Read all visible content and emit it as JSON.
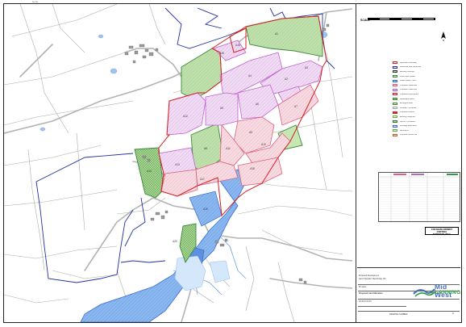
{
  "drawing": {
    "top_note": "Plan Ref:",
    "scale_label": "SCALE",
    "north_symbol": "N",
    "development_note": "FOR DEVELOPMENT\nCONTROL\nPURPOSES ONLY",
    "title_block": {
      "project": "Proposed Development",
      "subtitle": "Land Opposite: Sketchmap 123",
      "name_label": "M Loane",
      "drawing_title": "Proposed Land Allocation",
      "drawing_number": "20-20-P-01-03",
      "footer": "DRAWING NUMBER",
      "sheet": "A"
    },
    "logo": {
      "line1": "Mid West",
      "line2": "PLANNING"
    }
  },
  "map": {
    "parcels": [
      {
        "id": "A1",
        "label": "A1"
      },
      {
        "id": "A2",
        "label": "A2"
      },
      {
        "id": "A3",
        "label": "A3"
      },
      {
        "id": "A4",
        "label": "A4"
      },
      {
        "id": "A5",
        "label": "A5"
      },
      {
        "id": "A6",
        "label": "A6"
      },
      {
        "id": "A7",
        "label": "A7"
      },
      {
        "id": "A8",
        "label": "A8"
      },
      {
        "id": "A9",
        "label": "A9"
      },
      {
        "id": "A10",
        "label": "A10"
      },
      {
        "id": "A11",
        "label": "A11"
      },
      {
        "id": "A12",
        "label": "A12"
      },
      {
        "id": "A13",
        "label": "A13"
      },
      {
        "id": "A14",
        "label": "A14"
      },
      {
        "id": "A15",
        "label": "A15"
      },
      {
        "id": "A16",
        "label": "A16"
      },
      {
        "id": "A17",
        "label": "A17"
      },
      {
        "id": "A18",
        "label": "A18"
      },
      {
        "id": "A19",
        "label": "A19"
      },
      {
        "id": "A20",
        "label": "A20"
      }
    ]
  },
  "legend": {
    "items": [
      {
        "label": "Application boundary",
        "stroke": "#d62020",
        "fill": "none"
      },
      {
        "label": "Additional land ownership",
        "stroke": "#2030a0",
        "fill": "none"
      },
      {
        "label": "Existing buildings",
        "stroke": "#333333",
        "fill": "#cccccc"
      },
      {
        "label": "Public open space",
        "stroke": "#3a8a3a",
        "fill": "#c8e6b4"
      },
      {
        "label": "Water bodies / flood",
        "stroke": "#3a6ad4",
        "fill": "#9ec4ef"
      },
      {
        "label": "Proposed residential",
        "stroke": "#d85a8a",
        "fill": "#f3c6d6"
      },
      {
        "label": "Proposed mixed use",
        "stroke": "#b060c0",
        "fill": "#ead0f0"
      },
      {
        "label": "Proposed employment",
        "stroke": "#d62020",
        "fill": "#f8d8d8"
      },
      {
        "label": "Landscape buffer",
        "stroke": "#3a8a3a",
        "fill": "#8cc878"
      },
      {
        "label": "Ecological area",
        "stroke": "#3a8a3a",
        "fill": "#dcf0c8"
      },
      {
        "label": "Footpath / cycleway",
        "stroke": "#a0a0a0",
        "fill": "none"
      },
      {
        "label": "Proposed access",
        "stroke": "#c03030",
        "fill": "#c03030"
      },
      {
        "label": "Existing hedgerow",
        "stroke": "#6ab04c",
        "fill": "none"
      },
      {
        "label": "Sports / recreation",
        "stroke": "#2f7a2f",
        "fill": "#b6dca6"
      },
      {
        "label": "Drainage attenuation",
        "stroke": "#3a6ad4",
        "fill": "#cfe2f7"
      },
      {
        "label": "Allotments",
        "stroke": "#6aa64a",
        "fill": "#e5f2d5"
      },
      {
        "label": "Proposed school site",
        "stroke": "#b06030",
        "fill": "#f0d0b0"
      }
    ]
  },
  "colors": {
    "boundary_red": "#d62020",
    "boundary_blue": "#2030a0",
    "green_space": "#b7dca3",
    "pink_area": "#f5d4dc",
    "lilac_area": "#ecd3f0",
    "water_blue": "#7fb0ec",
    "road_grey": "#b3b3b3",
    "field_line": "#9aa59a"
  }
}
